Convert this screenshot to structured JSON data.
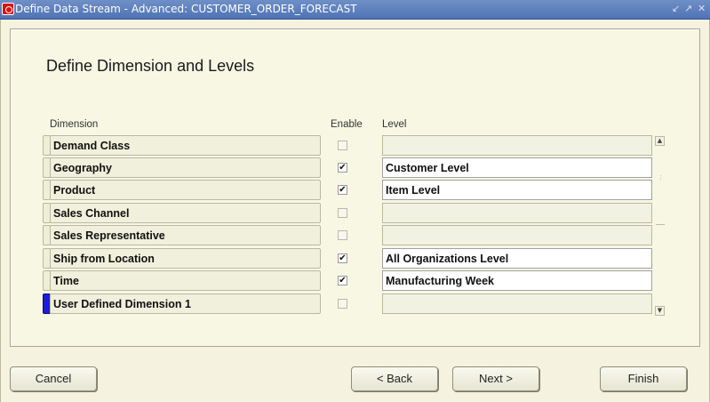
{
  "window": {
    "title": "Define Data Stream - Advanced: CUSTOMER_ORDER_FORECAST",
    "controls": [
      "↙",
      "↗",
      "✕"
    ]
  },
  "panel": {
    "heading": "Define Dimension and Levels",
    "columns": {
      "dimension": "Dimension",
      "enable": "Enable",
      "level": "Level"
    },
    "rows": [
      {
        "dimension": "Demand Class",
        "enabled": false,
        "enable_mark": "",
        "level": ""
      },
      {
        "dimension": "Geography",
        "enabled": true,
        "enable_mark": "✔",
        "level": "Customer Level"
      },
      {
        "dimension": "Product",
        "enabled": true,
        "enable_mark": "✔",
        "level": "Item Level"
      },
      {
        "dimension": "Sales Channel",
        "enabled": false,
        "enable_mark": "",
        "level": ""
      },
      {
        "dimension": "Sales Representative",
        "enabled": false,
        "enable_mark": "",
        "level": ""
      },
      {
        "dimension": "Ship from Location",
        "enabled": true,
        "enable_mark": "✔",
        "level": "All Organizations Level"
      },
      {
        "dimension": "Time",
        "enabled": true,
        "enable_mark": "✔",
        "level": "Manufacturing Week"
      },
      {
        "dimension": "User Defined Dimension 1",
        "enabled": false,
        "enable_mark": "",
        "level": ""
      }
    ],
    "scroll": {
      "up": "▲",
      "down": "▼",
      "grip": "⋮"
    }
  },
  "buttons": {
    "cancel": "Cancel",
    "back": "< Back",
    "next": "Next >",
    "finish": "Finish"
  }
}
